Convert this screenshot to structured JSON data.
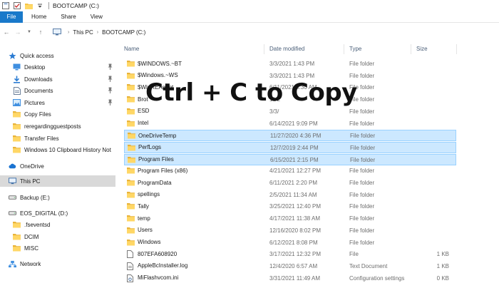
{
  "window": {
    "title": "BOOTCAMP (C:)",
    "quick_access_toolbar": [
      "save-icon",
      "checkbox-icon",
      "folder-icon",
      "dropdown-icon"
    ]
  },
  "ribbon": {
    "tabs": [
      "File",
      "Home",
      "Share",
      "View"
    ],
    "accent_color": "#1979ca"
  },
  "addressbar": {
    "breadcrumb": [
      "This PC",
      "BOOTCAMP (C:)"
    ]
  },
  "sidebar": {
    "items": [
      {
        "label": "Quick access",
        "icon": "star-icon",
        "pinned": false
      },
      {
        "label": "Desktop",
        "icon": "desktop-icon",
        "pinned": true
      },
      {
        "label": "Downloads",
        "icon": "download-icon",
        "pinned": true
      },
      {
        "label": "Documents",
        "icon": "documents-icon",
        "pinned": true
      },
      {
        "label": "Pictures",
        "icon": "pictures-icon",
        "pinned": true
      },
      {
        "label": "Copy Files",
        "icon": "folder-icon",
        "pinned": false
      },
      {
        "label": "reregardingguestposts",
        "icon": "folder-icon",
        "pinned": false
      },
      {
        "label": "Transfer Files",
        "icon": "folder-icon",
        "pinned": false
      },
      {
        "label": "Windows 10 Clipboard History Not",
        "icon": "folder-icon",
        "pinned": false
      },
      {
        "label": "OneDrive",
        "icon": "cloud-icon",
        "pinned": false
      },
      {
        "label": "This PC",
        "icon": "computer-icon",
        "pinned": false,
        "selected": true
      },
      {
        "label": "Backup  (E:)",
        "icon": "drive-icon",
        "pinned": false
      },
      {
        "label": "EOS_DIGITAL (D:)",
        "icon": "drive-icon",
        "pinned": false
      },
      {
        "label": ".fseventsd",
        "icon": "folder-icon",
        "pinned": false
      },
      {
        "label": "DCIM",
        "icon": "folder-icon",
        "pinned": false
      },
      {
        "label": "MISC",
        "icon": "folder-icon",
        "pinned": false
      },
      {
        "label": "Network",
        "icon": "network-icon",
        "pinned": false
      }
    ]
  },
  "filelist": {
    "columns": [
      "Name",
      "Date modified",
      "Type",
      "Size"
    ],
    "rows": [
      {
        "name": "$WINDOWS.~BT",
        "date": "3/3/2021 1:43 PM",
        "type": "File folder",
        "size": "",
        "icon": "folder-icon",
        "selected": false
      },
      {
        "name": "$Windows.~WS",
        "date": "3/3/2021 1:43 PM",
        "type": "File folder",
        "size": "",
        "icon": "folder-icon",
        "selected": false
      },
      {
        "name": "$WinREAgent",
        "date": "6/11/2021 8:30 AM",
        "type": "File folder",
        "size": "",
        "icon": "folder-icon",
        "selected": false
      },
      {
        "name": "Brot",
        "date": "11/2",
        "type": "File folder",
        "size": "",
        "icon": "folder-icon",
        "selected": false
      },
      {
        "name": "ESD",
        "date": "3/3/",
        "type": "File folder",
        "size": "",
        "icon": "folder-icon",
        "selected": false
      },
      {
        "name": "Intel",
        "date": "6/14/2021 9:09 PM",
        "type": "File folder",
        "size": "",
        "icon": "folder-icon",
        "selected": false
      },
      {
        "name": "OneDriveTemp",
        "date": "11/27/2020 4:36 PM",
        "type": "File folder",
        "size": "",
        "icon": "folder-icon",
        "selected": true
      },
      {
        "name": "PerfLogs",
        "date": "12/7/2019 2:44 PM",
        "type": "File folder",
        "size": "",
        "icon": "folder-icon",
        "selected": true
      },
      {
        "name": "Program Files",
        "date": "6/15/2021 2:15 PM",
        "type": "File folder",
        "size": "",
        "icon": "folder-icon",
        "selected": true
      },
      {
        "name": "Program Files (x86)",
        "date": "4/21/2021 12:27 PM",
        "type": "File folder",
        "size": "",
        "icon": "folder-icon",
        "selected": false
      },
      {
        "name": "ProgramData",
        "date": "6/11/2021 2:20 PM",
        "type": "File folder",
        "size": "",
        "icon": "folder-icon",
        "selected": false
      },
      {
        "name": "spellings",
        "date": "2/5/2021 11:34 AM",
        "type": "File folder",
        "size": "",
        "icon": "folder-icon",
        "selected": false
      },
      {
        "name": "Tally",
        "date": "3/25/2021 12:40 PM",
        "type": "File folder",
        "size": "",
        "icon": "folder-icon",
        "selected": false
      },
      {
        "name": "temp",
        "date": "4/17/2021 11:38 AM",
        "type": "File folder",
        "size": "",
        "icon": "folder-icon",
        "selected": false
      },
      {
        "name": "Users",
        "date": "12/16/2020 8:02 PM",
        "type": "File folder",
        "size": "",
        "icon": "folder-icon",
        "selected": false
      },
      {
        "name": "Windows",
        "date": "6/12/2021 8:08 PM",
        "type": "File folder",
        "size": "",
        "icon": "folder-icon",
        "selected": false
      },
      {
        "name": "807EFA608920",
        "date": "3/17/2021 12:32 PM",
        "type": "File",
        "size": "1 KB",
        "icon": "file-icon",
        "selected": false
      },
      {
        "name": "AppleBcInstaller.log",
        "date": "12/4/2020 6:57 AM",
        "type": "Text Document",
        "size": "1 KB",
        "icon": "text-file-icon",
        "selected": false
      },
      {
        "name": "MiFlashvcom.ini",
        "date": "3/31/2021 11:49 AM",
        "type": "Configuration settings",
        "size": "0 KB",
        "icon": "settings-file-icon",
        "selected": false
      }
    ],
    "selection_color": "#cce8ff"
  },
  "overlay": {
    "caption": "Ctrl + C to Copy"
  }
}
